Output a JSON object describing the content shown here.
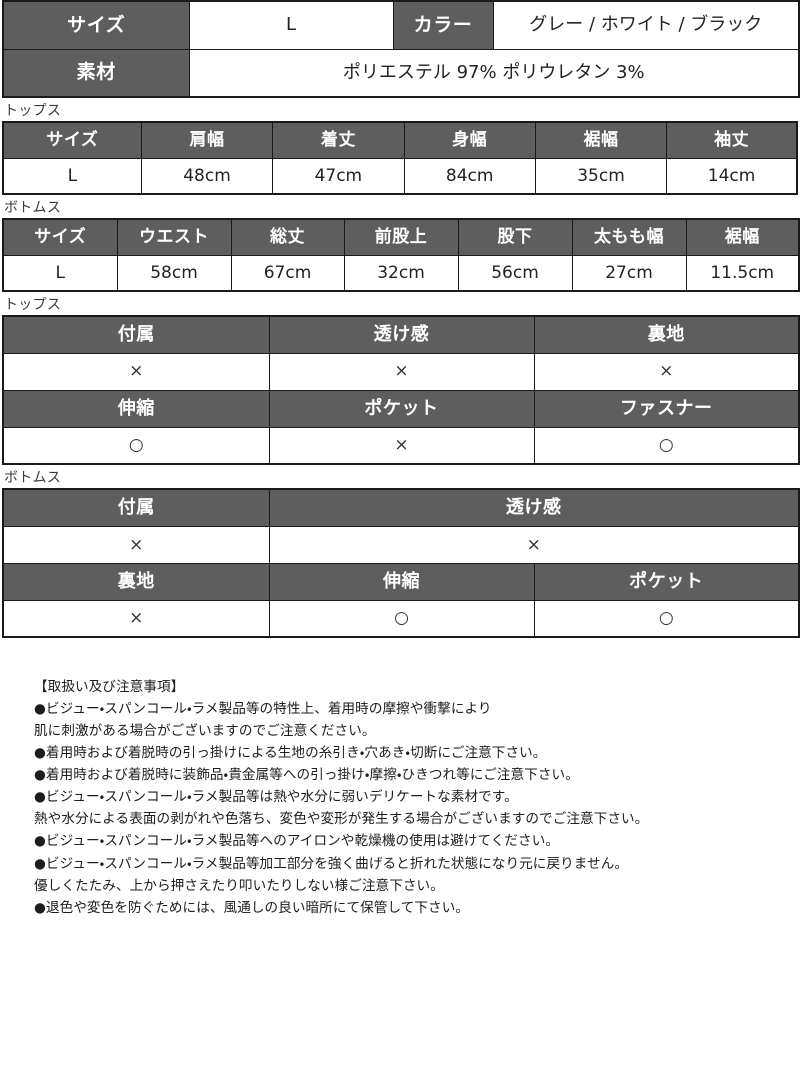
{
  "main_table": {
    "rows": [
      {
        "cells": [
          {
            "text": "サイズ",
            "type": "header"
          },
          {
            "text": "L",
            "type": "value"
          },
          {
            "text": "カラー",
            "type": "header"
          },
          {
            "text": "グレー / ホワイト / ブラック",
            "type": "value"
          }
        ]
      },
      {
        "cells": [
          {
            "text": "素材",
            "type": "header"
          },
          {
            "text": "ポリエステル 97%  ポリウレタン 3%",
            "type": "value"
          }
        ]
      }
    ]
  },
  "tops_measure": {
    "caption": "トップス",
    "headers": [
      "サイズ",
      "肩幅",
      "着丈",
      "身幅",
      "裾幅",
      "袖丈"
    ],
    "values": [
      "L",
      "48cm",
      "47cm",
      "84cm",
      "35cm",
      "14cm"
    ]
  },
  "bottoms_measure": {
    "caption": "ボトムス",
    "headers": [
      "サイズ",
      "ウエスト",
      "総丈",
      "前股上",
      "股下",
      "太もも幅",
      "裾幅"
    ],
    "values": [
      "L",
      "58cm",
      "67cm",
      "32cm",
      "56cm",
      "27cm",
      "11.5cm"
    ]
  },
  "tops_attr": {
    "caption": "トップス",
    "headers_row1": [
      "付属",
      "透け感",
      "裏地"
    ],
    "values_row1": [
      "×",
      "×",
      "×"
    ],
    "headers_row2": [
      "伸縮",
      "ポケット",
      "ファスナー"
    ],
    "values_row2": [
      "○",
      "×",
      "○"
    ]
  },
  "bottoms_attr": {
    "caption": "ボトムス",
    "headers_row1": [
      "付属",
      "透け感"
    ],
    "values_row1": [
      "×",
      "×"
    ],
    "headers_row2": [
      "裏地",
      "伸縮",
      "ポケット"
    ],
    "values_row2": [
      "×",
      "○",
      "○"
    ]
  },
  "notes": {
    "title": "【取扱い及び注意事項】",
    "lines": [
      "●ビジュー・スパンコール・ラメ製品等の特性上、着用時の摩擦や衝撃により",
      "肌に刺激がある場合がございますのでご注意ください。",
      "●着用時および着脱時の引っ掛けによる生地の糸引き・穴あき・切断にご注意下さい。",
      "●着用時および着脱時に装飾品・貴金属等への引っ掛け・摩擦・ひきつれ等にご注意下さい。",
      "●ビジュー・スパンコール・ラメ製品等は熱や水分に弱いデリケートな素材です。",
      "熱や水分による表面の剥がれや色落ち、変色や変形が発生する場合がございますのでご注意下さい。",
      "●ビジュー・スパンコール・ラメ製品等へのアイロンや乾燥機の使用は避けてください。",
      "●ビジュー・スパンコール・ラメ製品等加工部分を強く曲げると折れた状態になり元に戻りません。",
      "優しくたたみ、上から押さえたり叩いたりしない様ご注意下さい。",
      "●退色や変色を防ぐためには、風通しの良い暗所にて保管して下さい。"
    ]
  },
  "colors": {
    "header_bg": "#5e5e5e",
    "header_text": "#ffffff",
    "cell_bg": "#ffffff",
    "border": "#1a1a1a",
    "body_text": "#1d1d1d"
  }
}
